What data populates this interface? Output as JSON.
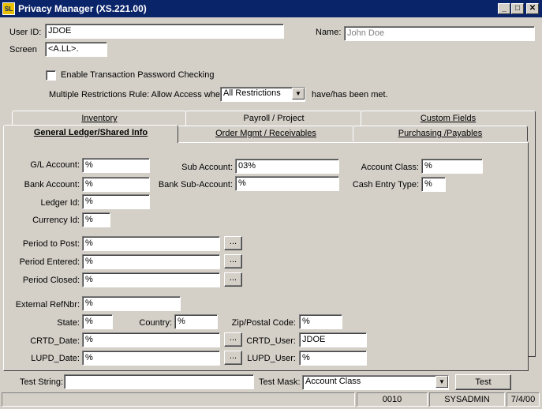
{
  "window": {
    "title": "Privacy Manager  (XS.221.00)",
    "icon_text": "SL",
    "min_glyph": "_",
    "max_glyph": "□",
    "close_glyph": "✕"
  },
  "header": {
    "user_id_label": "User ID:",
    "user_id_value": "JDOE",
    "name_label": "Name:",
    "name_value": "John Doe",
    "screen_label": "Screen",
    "screen_value": "<A.LL>.",
    "enable_tx_label": "Enable Transaction Password Checking",
    "enable_tx_checked": false,
    "multi_rule_label": "Multiple Restrictions Rule: Allow Access when",
    "multi_rule_value": "All Restrictions",
    "multi_rule_suffix": "have/has been met."
  },
  "tabs": {
    "row1": [
      "Inventory",
      "Payroll / Project",
      "Custom Fields"
    ],
    "row2": [
      "General Ledger/Shared Info",
      "Order Mgmt / Receivables",
      "Purchasing /Payables"
    ],
    "active": "General Ledger/Shared Info"
  },
  "form": {
    "gl_account_label": "G/L Account:",
    "gl_account_value": "%",
    "sub_account_label": "Sub Account:",
    "sub_account_value": "03%",
    "account_class_label": "Account Class:",
    "account_class_value": "%",
    "bank_account_label": "Bank Account:",
    "bank_account_value": "%",
    "bank_sub_account_label": "Bank Sub-Account:",
    "bank_sub_account_value": "%",
    "cash_entry_type_label": "Cash Entry Type:",
    "cash_entry_type_value": "%",
    "ledger_id_label": "Ledger Id:",
    "ledger_id_value": "%",
    "currency_id_label": "Currency Id:",
    "currency_id_value": "%",
    "period_to_post_label": "Period to Post:",
    "period_to_post_value": "%",
    "period_entered_label": "Period Entered:",
    "period_entered_value": "%",
    "period_closed_label": "Period Closed:",
    "period_closed_value": "%",
    "external_refnbr_label": "External RefNbr:",
    "external_refnbr_value": "%",
    "state_label": "State:",
    "state_value": "%",
    "country_label": "Country:",
    "country_value": "%",
    "zip_label": "Zip/Postal Code:",
    "zip_value": "%",
    "crtd_date_label": "CRTD_Date:",
    "crtd_date_value": "%",
    "crtd_user_label": "CRTD_User:",
    "crtd_user_value": "JDOE",
    "lupd_date_label": "LUPD_Date:",
    "lupd_date_value": "%",
    "lupd_user_label": "LUPD_User:",
    "lupd_user_value": "%",
    "ellipsis": "..."
  },
  "footer": {
    "test_string_label": "Test String:",
    "test_string_value": "",
    "test_mask_label": "Test Mask:",
    "test_mask_value": "Account Class",
    "test_button": "Test"
  },
  "status": {
    "field1": "",
    "field2": "0010",
    "field3": "SYSADMIN",
    "field4": "7/4/00"
  }
}
